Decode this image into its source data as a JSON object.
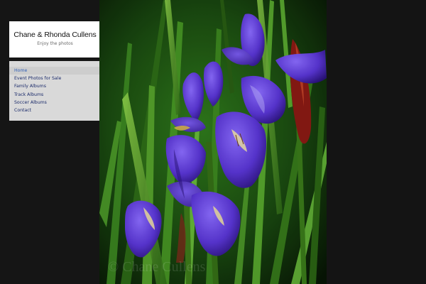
{
  "site": {
    "title": "Chane & Rhonda Cullens",
    "subtitle": "Enjoy the photos"
  },
  "nav": {
    "items": [
      {
        "label": "Home",
        "active": true
      },
      {
        "label": "Event Photos for Sale",
        "active": false
      },
      {
        "label": "Family Albums",
        "active": false
      },
      {
        "label": "Track Albums",
        "active": false
      },
      {
        "label": "Soccer Albums",
        "active": false
      },
      {
        "label": "Contact",
        "active": false
      }
    ]
  },
  "photo": {
    "subject": "purple iris flowers",
    "watermark": "© Chane Cullens"
  },
  "colors": {
    "background": "#141414",
    "header_bg": "#ffffff",
    "nav_bg": "#d9d9d9",
    "nav_link": "#1a2a6a",
    "nav_active": "#2f5fb8",
    "iris_purple": "#5a3bd0",
    "leaf_green": "#4f9a2a"
  }
}
